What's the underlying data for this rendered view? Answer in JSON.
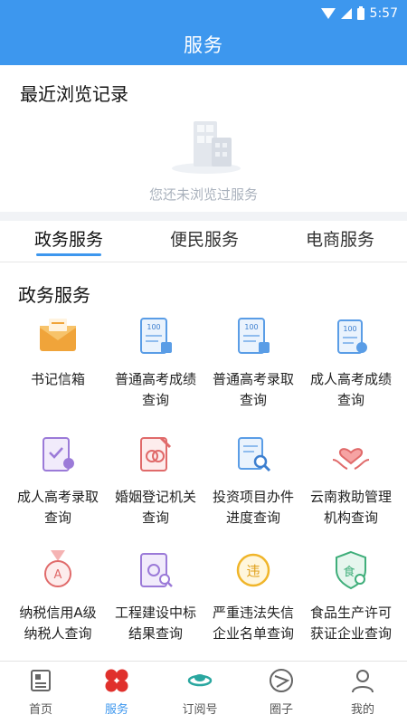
{
  "status_bar": {
    "time": "5:57"
  },
  "header": {
    "title": "服务"
  },
  "recent": {
    "title": "最近浏览记录",
    "empty_text": "您还未浏览过服务"
  },
  "tabs": [
    {
      "label": "政务服务",
      "active": true
    },
    {
      "label": "便民服务",
      "active": false
    },
    {
      "label": "电商服务",
      "active": false
    }
  ],
  "section": {
    "title": "政务服务"
  },
  "services": [
    {
      "label": "书记信箱",
      "icon": "mailbox-icon"
    },
    {
      "label": "普通高考成绩查询",
      "icon": "score-report-icon"
    },
    {
      "label": "普通高考录取查询",
      "icon": "admission-report-icon"
    },
    {
      "label": "成人高考成绩查询",
      "icon": "adult-score-icon"
    },
    {
      "label": "成人高考录取查询",
      "icon": "adult-admission-icon"
    },
    {
      "label": "婚姻登记机关查询",
      "icon": "marriage-registry-icon"
    },
    {
      "label": "投资项目办件进度查询",
      "icon": "investment-search-icon"
    },
    {
      "label": "云南救助管理机构查询",
      "icon": "rescue-hands-icon"
    },
    {
      "label": "纳税信用A级纳税人查询",
      "icon": "tax-medal-icon"
    },
    {
      "label": "工程建设中标结果查询",
      "icon": "construction-bid-icon"
    },
    {
      "label": "严重违法失信企业名单查询",
      "icon": "violation-icon"
    },
    {
      "label": "食品生产许可获证企业查询",
      "icon": "food-license-icon"
    }
  ],
  "bottom_nav": [
    {
      "label": "首页",
      "icon": "newspaper-icon",
      "active": false
    },
    {
      "label": "服务",
      "icon": "services-petals-icon",
      "active": true
    },
    {
      "label": "订阅号",
      "icon": "subscription-icon",
      "active": false
    },
    {
      "label": "圈子",
      "icon": "circle-icon",
      "active": false
    },
    {
      "label": "我的",
      "icon": "profile-icon",
      "active": false
    }
  ]
}
